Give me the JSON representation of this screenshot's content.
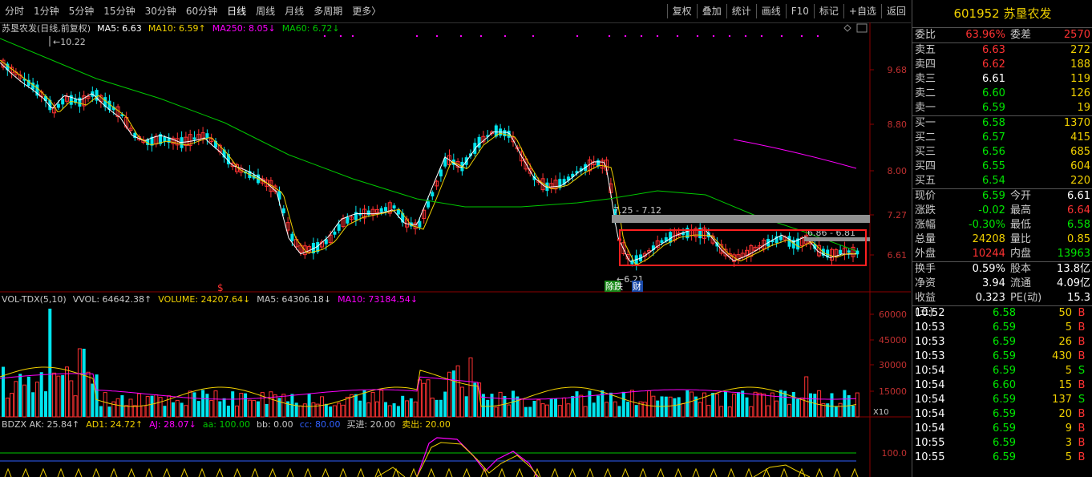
{
  "toolbar": {
    "periods": [
      "分时",
      "1分钟",
      "5分钟",
      "15分钟",
      "30分钟",
      "60分钟",
      "日线",
      "周线",
      "月线",
      "多周期",
      "更多〉"
    ],
    "active_period": "日线",
    "tools": [
      "复权",
      "叠加",
      "统计",
      "画线",
      "F10",
      "标记",
      "+自选",
      "返回"
    ]
  },
  "main_legend": {
    "title": "苏垦农发(日线,前复权)",
    "ma5": "MA5: 6.63",
    "ma10": "MA10: 6.59↑",
    "ma250": "MA250: 8.05↓",
    "ma60": "MA60: 6.72↓"
  },
  "main_axis": [
    "9.68",
    "8.80",
    "8.00",
    "7.27",
    "6.61"
  ],
  "annotations": {
    "high": "10.22",
    "low": "6.21",
    "range1": "7.25 - 7.12",
    "range2": "6.86 - 6.81",
    "dollar": "$",
    "tag1": "除",
    "tag2": "跌",
    "tag3": "财"
  },
  "vol_legend": {
    "name": "VOL-TDX(5,10)",
    "vvol": "VVOL: 64642.38↑",
    "volume": "VOLUME: 24207.64↓",
    "ma5": "MA5: 64306.18↓",
    "ma10": "MA10: 73184.54↓"
  },
  "vol_axis": [
    "60000",
    "45000",
    "30000",
    "15000"
  ],
  "vol_scale": "X10",
  "bdzx_legend": {
    "ak": "BDZX AK: 25.84↑",
    "ad1": "AD1: 24.72↑",
    "aj": "AJ: 28.07↓",
    "aa": "aa: 100.00",
    "bb": "bb: 0.00",
    "cc": "cc: 80.00",
    "buy": "买进: 20.00",
    "sell": "卖出: 20.00"
  },
  "bdzx_axis": [
    "100.0"
  ],
  "colors": {
    "up": "#ff3232",
    "down": "#00e5ee",
    "ma5": "#ffffff",
    "ma10": "#f0d000",
    "ma60": "#00c800",
    "ma250": "#ff00ff",
    "box": "#ff2020"
  },
  "stock": {
    "code": "601952",
    "name": "苏垦农发"
  },
  "order_book": {
    "weibi_label": "委比",
    "weibi": "63.96%",
    "weicha_label": "委差",
    "weicha": "2570",
    "asks": [
      {
        "label": "卖五",
        "price": "6.63",
        "vol": "272",
        "pc": "red"
      },
      {
        "label": "卖四",
        "price": "6.62",
        "vol": "188",
        "pc": "red"
      },
      {
        "label": "卖三",
        "price": "6.61",
        "vol": "119",
        "pc": "white"
      },
      {
        "label": "卖二",
        "price": "6.60",
        "vol": "126",
        "pc": "green"
      },
      {
        "label": "卖一",
        "price": "6.59",
        "vol": "19",
        "pc": "green"
      }
    ],
    "bids": [
      {
        "label": "买一",
        "price": "6.58",
        "vol": "1370",
        "pc": "green"
      },
      {
        "label": "买二",
        "price": "6.57",
        "vol": "415",
        "pc": "green"
      },
      {
        "label": "买三",
        "price": "6.56",
        "vol": "685",
        "pc": "green"
      },
      {
        "label": "买四",
        "price": "6.55",
        "vol": "604",
        "pc": "green"
      },
      {
        "label": "买五",
        "price": "6.54",
        "vol": "220",
        "pc": "green"
      }
    ]
  },
  "quote": [
    {
      "l1": "现价",
      "v1": "6.59",
      "c1": "green",
      "l2": "今开",
      "v2": "6.61",
      "c2": "white"
    },
    {
      "l1": "涨跌",
      "v1": "-0.02",
      "c1": "green",
      "l2": "最高",
      "v2": "6.64",
      "c2": "red"
    },
    {
      "l1": "涨幅",
      "v1": "-0.30%",
      "c1": "green",
      "l2": "最低",
      "v2": "6.58",
      "c2": "green"
    },
    {
      "l1": "总量",
      "v1": "24208",
      "c1": "yellow",
      "l2": "量比",
      "v2": "0.85",
      "c2": "yellow"
    },
    {
      "l1": "外盘",
      "v1": "10244",
      "c1": "red",
      "l2": "内盘",
      "v2": "13963",
      "c2": "green"
    }
  ],
  "stats": [
    {
      "l1": "换手",
      "v1": "0.59%",
      "l2": "股本",
      "v2": "13.8亿"
    },
    {
      "l1": "净资",
      "v1": "3.94",
      "l2": "流通",
      "v2": "4.09亿"
    },
    {
      "l1": "收益(三)",
      "v1": "0.323",
      "l2": "PE(动)",
      "v2": "15.3"
    }
  ],
  "ticks": [
    {
      "time": "10:52",
      "price": "6.58",
      "vol": "50",
      "bs": "B"
    },
    {
      "time": "10:53",
      "price": "6.59",
      "vol": "5",
      "bs": "B"
    },
    {
      "time": "10:53",
      "price": "6.59",
      "vol": "26",
      "bs": "B"
    },
    {
      "time": "10:53",
      "price": "6.59",
      "vol": "430",
      "bs": "B"
    },
    {
      "time": "10:54",
      "price": "6.59",
      "vol": "5",
      "bs": "S"
    },
    {
      "time": "10:54",
      "price": "6.60",
      "vol": "15",
      "bs": "B"
    },
    {
      "time": "10:54",
      "price": "6.59",
      "vol": "137",
      "bs": "S"
    },
    {
      "time": "10:54",
      "price": "6.59",
      "vol": "20",
      "bs": "B"
    },
    {
      "time": "10:54",
      "price": "6.59",
      "vol": "9",
      "bs": "B"
    },
    {
      "time": "10:55",
      "price": "6.59",
      "vol": "3",
      "bs": "B"
    },
    {
      "time": "10:55",
      "price": "6.59",
      "vol": "5",
      "bs": "B"
    }
  ]
}
